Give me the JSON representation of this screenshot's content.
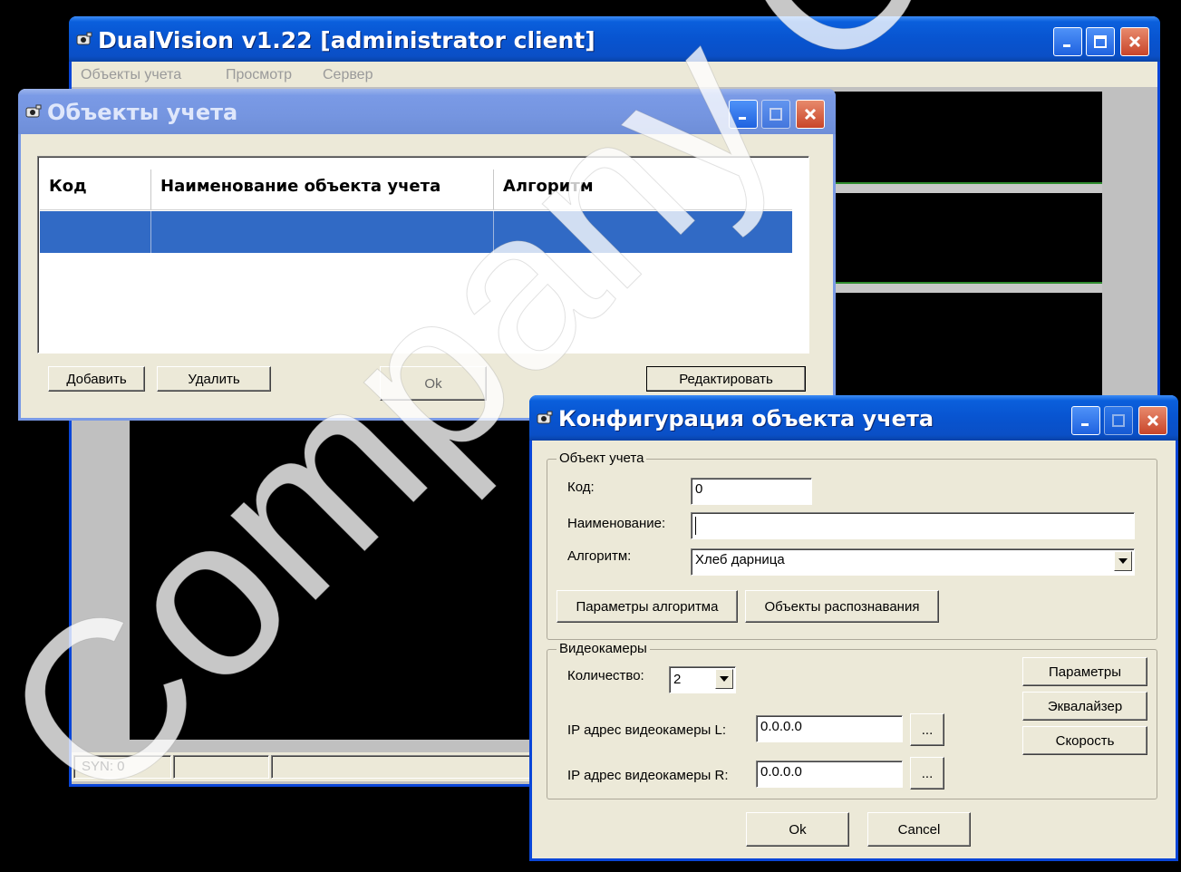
{
  "main_window": {
    "title": "DualVision v1.22 [administrator client]",
    "menu": [
      "Объекты учета",
      "Просмотр",
      "Сервер"
    ],
    "status": {
      "syn": "SYN: 0"
    }
  },
  "objects_window": {
    "title": "Объекты учета",
    "columns": [
      "Код",
      "Наименование объекта учета",
      "Алгоритм"
    ],
    "buttons": {
      "add": "Добавить",
      "delete": "Удалить",
      "ok": "Ok",
      "edit": "Редактировать"
    }
  },
  "config_window": {
    "title": "Конфигурация объекта учета",
    "object_group": {
      "title": "Объект учета",
      "code_label": "Код:",
      "code_value": "0",
      "name_label": "Наименование:",
      "name_value": "",
      "algorithm_label": "Алгоритм:",
      "algorithm_value": "Хлеб дарница",
      "algo_params_button": "Параметры алгоритма",
      "recognition_objects_button": "Объекты распознавания"
    },
    "cameras_group": {
      "title": "Видеокамеры",
      "count_label": "Количество:",
      "count_value": "2",
      "ip_left_label": "IP адрес видеокамеры L:",
      "ip_left_value": "0.0.0.0",
      "ip_right_label": "IP адрес видеокамеры R:",
      "ip_right_value": "0.0.0.0",
      "browse_label": "...",
      "params_button": "Параметры",
      "equalizer_button": "Эквалайзер",
      "speed_button": "Скорость"
    },
    "ok_button": "Ok",
    "cancel_button": "Cancel"
  },
  "watermark": "Company Com",
  "colors": {
    "window_border": "#0a46d8",
    "titlebar": "#0854d0",
    "selection": "#316ac5",
    "dialog_bg": "#ece9d8",
    "close_button": "#c8452a",
    "video_separator": "#2e8b2e"
  },
  "icons": [
    "app-icon",
    "minimize-icon",
    "maximize-icon",
    "close-icon",
    "dropdown-arrow-icon"
  ]
}
